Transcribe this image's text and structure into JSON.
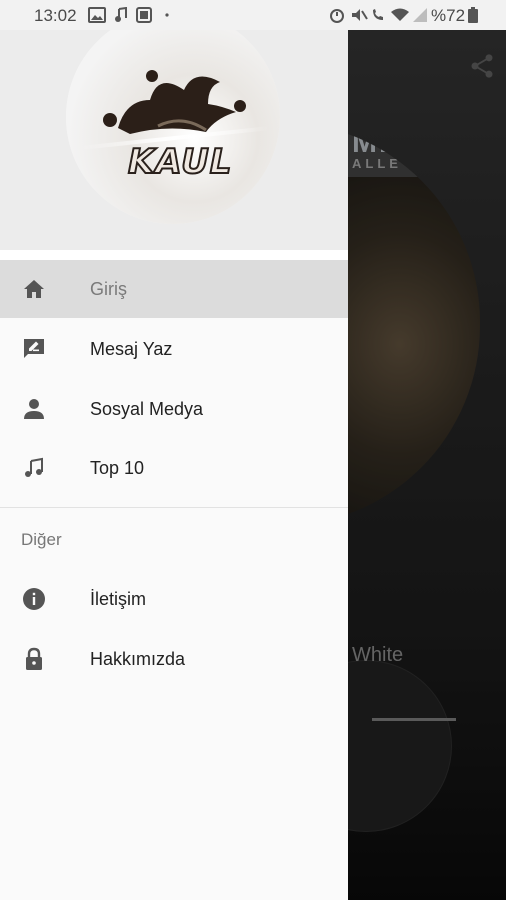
{
  "status_bar": {
    "time": "13:02",
    "battery": "%72"
  },
  "drawer": {
    "logo_text": "KAUL",
    "menu": [
      {
        "label": "Giriş",
        "icon": "home-icon",
        "active": true
      },
      {
        "label": "Mesaj Yaz",
        "icon": "message-edit-icon",
        "active": false
      },
      {
        "label": "Sosyal Medya",
        "icon": "person-icon",
        "active": false
      },
      {
        "label": "Top 10",
        "icon": "music-note-icon",
        "active": false
      }
    ],
    "section_title": "Diğer",
    "other_menu": [
      {
        "label": "İletişim",
        "icon": "info-icon"
      },
      {
        "label": "Hakkımızda",
        "icon": "lock-icon"
      }
    ]
  },
  "background_app": {
    "song_fragment": "White",
    "art_fragment_title": "MEN",
    "art_fragment_sub": "ALLE"
  },
  "colors": {
    "drawer_bg": "#fafafa",
    "header_bg": "#ececec",
    "active_item_bg": "#dcdcdc",
    "icon_color": "#555555"
  }
}
